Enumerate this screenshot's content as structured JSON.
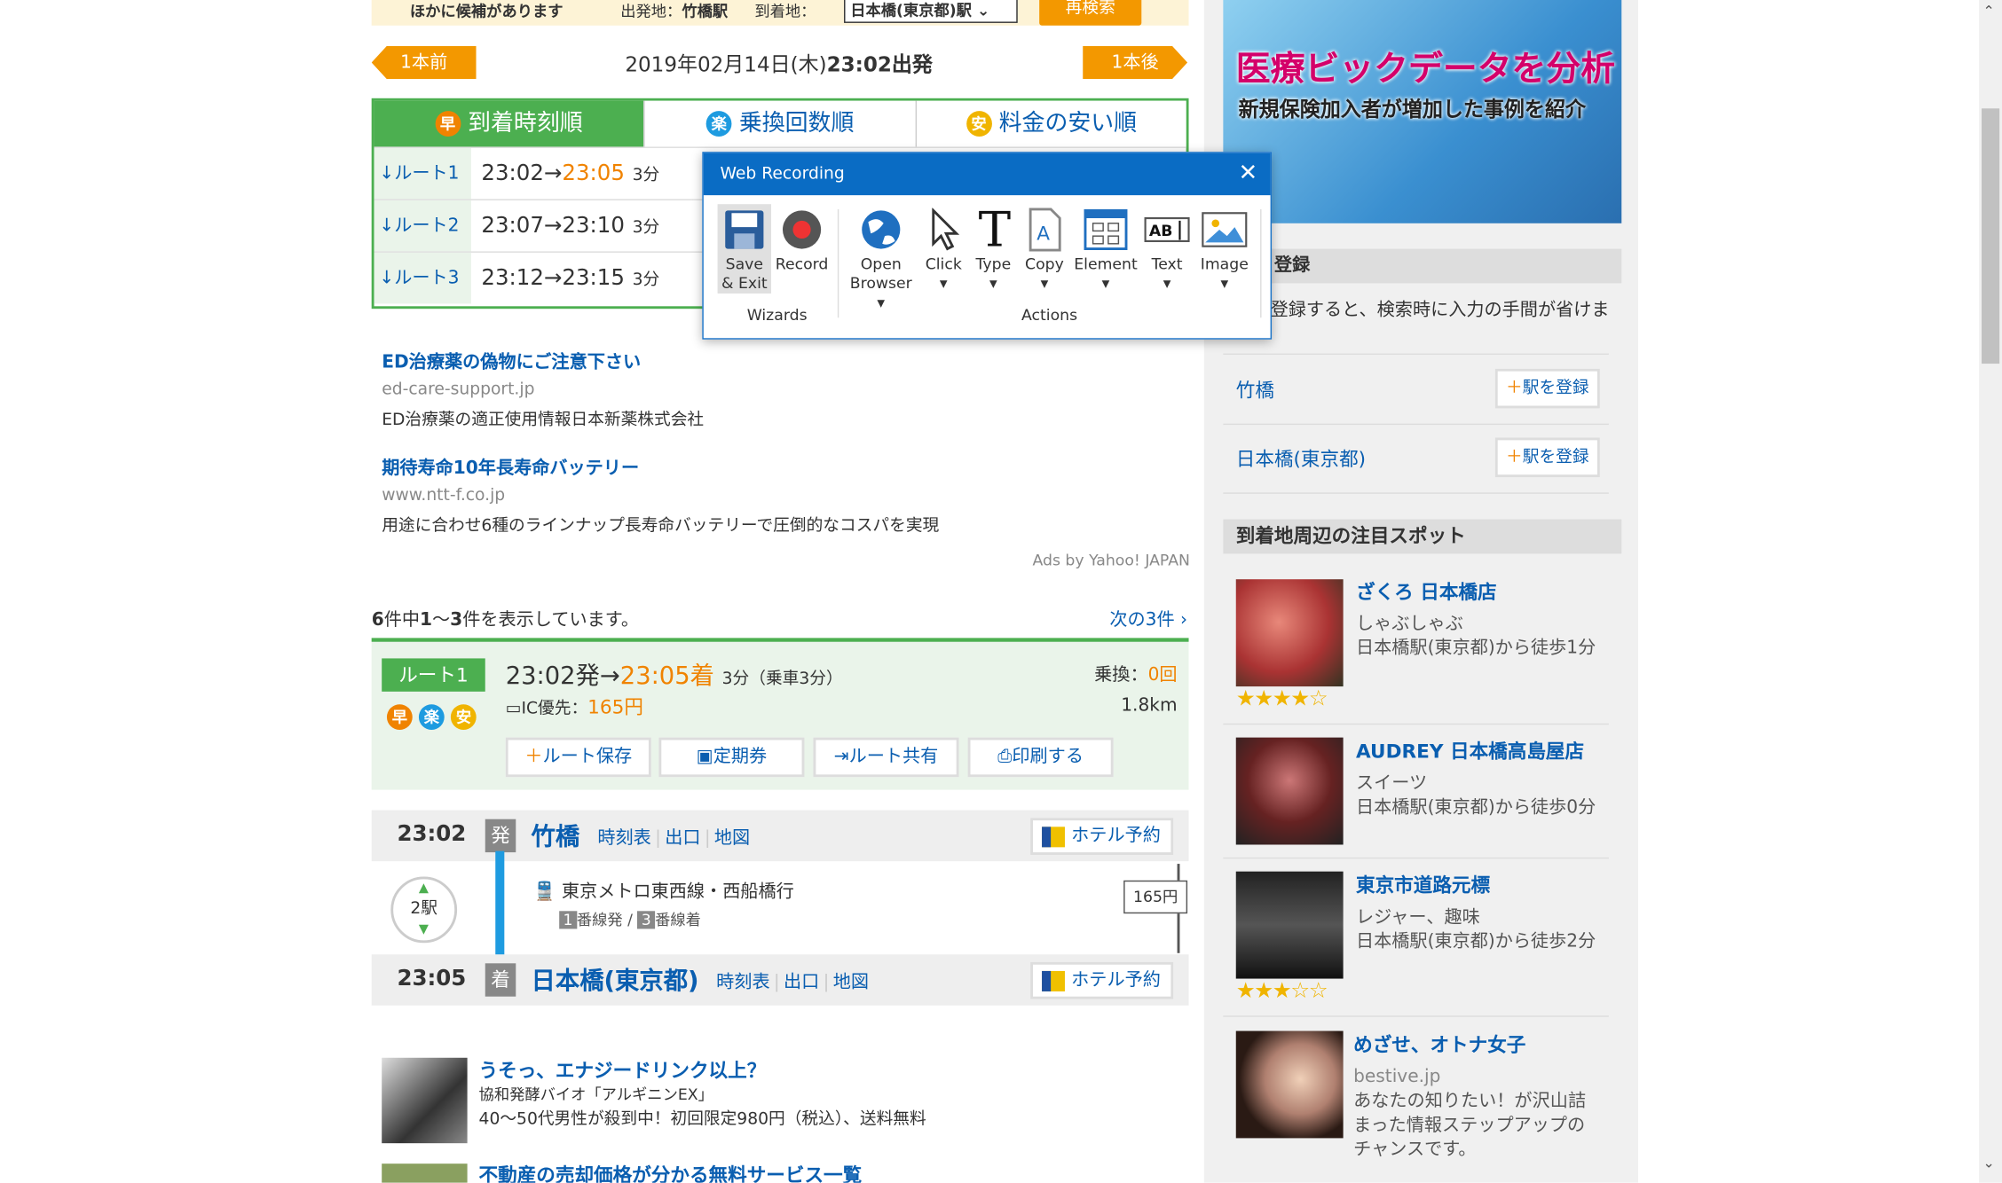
{
  "search_bar": {
    "label": "ほかに候補があります",
    "from_label": "出発地：",
    "from_value": "竹橋駅",
    "to_label": "到着地：",
    "to_value": "日本橋(東京都)駅",
    "search_button": "再検索"
  },
  "nav": {
    "prev": "1本前",
    "next": "1本後",
    "date": "2019年02月14日(木)",
    "depart": "23:02出発"
  },
  "tabs": [
    {
      "badge": "早",
      "label": "到着時刻順"
    },
    {
      "badge": "楽",
      "label": "乗換回数順"
    },
    {
      "badge": "安",
      "label": "料金の安い順"
    }
  ],
  "routes": [
    {
      "label": "↓ルート1",
      "dep": "23:02→",
      "arr": "23:05",
      "dur": "3分"
    },
    {
      "label": "↓ルート2",
      "dep": "23:07→",
      "arr": "23:10",
      "dur": "3分"
    },
    {
      "label": "↓ルート3",
      "dep": "23:12→",
      "arr": "23:15",
      "dur": "3分"
    }
  ],
  "ads": [
    {
      "title": "ED治療薬の偽物にご注意下さい",
      "url": "ed-care-support.jp",
      "desc": "ED治療薬の適正使用情報日本新薬株式会社"
    },
    {
      "title": "期待寿命10年長寿命バッテリー",
      "url": "www.ntt-f.co.jp",
      "desc": "用途に合わせ6種のラインナップ長寿命バッテリーで圧倒的なコスパを実現"
    }
  ],
  "ads_by": "Ads by Yahoo! JAPAN",
  "count": {
    "total": "6",
    "t1": "件中",
    "range_a": "1",
    "t2": "～",
    "range_b": "3",
    "t3": "件を表示しています。"
  },
  "next3": "次の3件",
  "route_detail": {
    "tag": "ルート1",
    "dep": "23:02発→",
    "arr": "23:05着",
    "dur": "3分（乗車3分）",
    "transfer_label": "乗換：",
    "transfer_value": "0回",
    "fare_label": "IC優先：",
    "fare_value": "165円",
    "distance": "1.8km",
    "badges": [
      "早",
      "楽",
      "安"
    ],
    "buttons": [
      "ルート保存",
      "定期券",
      "ルート共有",
      "印刷する"
    ]
  },
  "stations": [
    {
      "time": "23:02",
      "tag": "発",
      "name": "竹橋",
      "links": [
        "時刻表",
        "出口",
        "地図"
      ],
      "hotel": "ホテル予約"
    },
    {
      "time": "23:05",
      "tag": "着",
      "name": "日本橋(東京都)",
      "links": [
        "時刻表",
        "出口",
        "地図"
      ],
      "hotel": "ホテル予約"
    }
  ],
  "segment": {
    "stops": "2駅",
    "line": "東京メトロ東西線・西船橋行",
    "dep_track_num": "1",
    "dep_track": "番線発",
    "sep": "/",
    "arr_track_num": "3",
    "arr_track": "番線着",
    "fare": "165円"
  },
  "lower_ads": [
    {
      "title": "うそっ、エナジードリンク以上？",
      "sub": "協和発酵バイオ「アルギニンEX」",
      "desc": "40～50代男性が殺到中！初回限定980円（税込）、送料無料"
    },
    {
      "title": "不動産の売却価格が分かる無料サービス一覧",
      "sub": "",
      "desc": ""
    }
  ],
  "sidebar": {
    "banner_title": "医療ビックデータを分析",
    "banner_sub": "新規保険加入者が増加した事例を紹介",
    "register_header": "登録",
    "register_desc": "登録すると、検索時に入力の手間が省けま",
    "stations": [
      {
        "name": "竹橋",
        "button": "駅を登録"
      },
      {
        "name": "日本橋(東京都)",
        "button": "駅を登録"
      }
    ],
    "spots_header": "到着地周辺の注目スポット",
    "spots": [
      {
        "title": "ざくろ 日本橋店",
        "cat": "しゃぶしゃぶ",
        "dist": "日本橋駅(東京都)から徒歩1分",
        "stars": "★★★★☆"
      },
      {
        "title": "AUDREY 日本橋高島屋店",
        "cat": "スイーツ",
        "dist": "日本橋駅(東京都)から徒歩0分",
        "stars": ""
      },
      {
        "title": "東京市道路元標",
        "cat": "レジャー、趣味",
        "dist": "日本橋駅(東京都)から徒歩2分",
        "stars": "★★★☆☆"
      },
      {
        "title": "めざせ、オトナ女子",
        "cat": "bestive.jp",
        "dist": "あなたの知りたい！が沢山詰まった情報ステップアップのチャンスです。",
        "stars": ""
      }
    ]
  },
  "dialog": {
    "title": "Web Recording",
    "close": "✕",
    "tools": [
      {
        "label1": "Save",
        "label2": "& Exit",
        "icon": "save-icon"
      },
      {
        "label1": "Record",
        "label2": "",
        "icon": "record-icon"
      },
      {
        "label1": "Open",
        "label2": "Browser ▾",
        "icon": "globe-icon"
      },
      {
        "label1": "Click",
        "label2": "▾",
        "icon": "cursor-icon"
      },
      {
        "label1": "Type",
        "label2": "▾",
        "icon": "type-icon"
      },
      {
        "label1": "Copy",
        "label2": "▾",
        "icon": "copy-icon"
      },
      {
        "label1": "Element",
        "label2": "▾",
        "icon": "element-icon"
      },
      {
        "label1": "Text",
        "label2": "▾",
        "icon": "text-icon"
      },
      {
        "label1": "Image",
        "label2": "▾",
        "icon": "image-icon"
      }
    ],
    "group_wizards": "Wizards",
    "group_actions": "Actions"
  },
  "colors": {
    "accent": "#4caf50",
    "orange": "#f39800",
    "link": "#0a5eb0",
    "dialog": "#0a6cc4"
  }
}
